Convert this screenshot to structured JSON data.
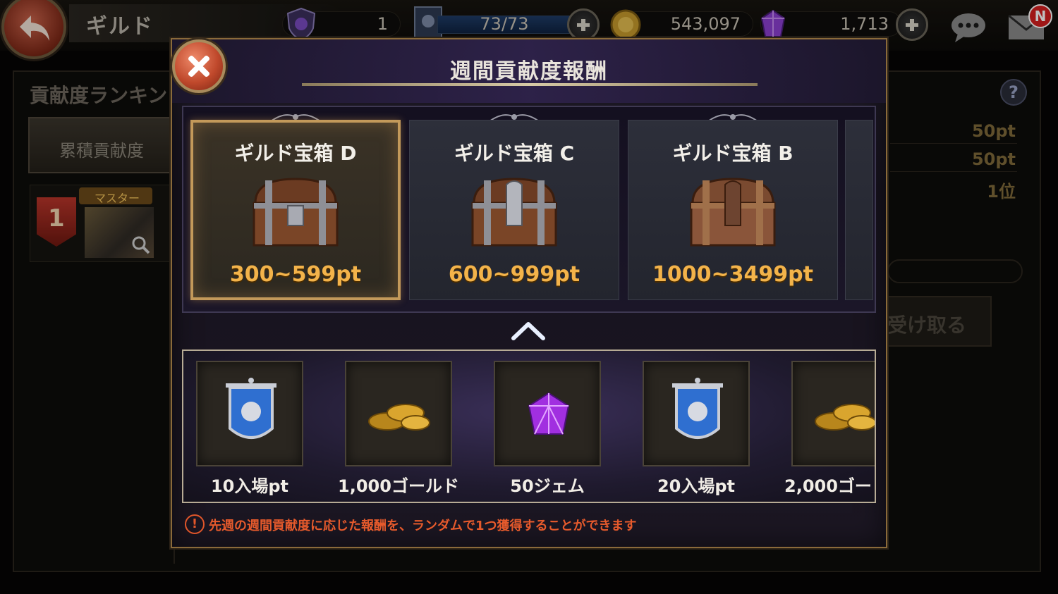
{
  "topbar": {
    "title": "ギルド",
    "guild_points": "1",
    "stamina": "73/73",
    "gold": "543,097",
    "gems": "1,713",
    "mail_badge": "N"
  },
  "background": {
    "ranking_title": "貢献度ランキン",
    "tab_cumulative": "累積貢献度",
    "rank_number": "1",
    "master_label": "マスター",
    "row_values": [
      "50pt",
      "50pt",
      "1位"
    ],
    "receive_button": "受け取る"
  },
  "modal": {
    "title": "週間貢献度報酬",
    "chests": [
      {
        "name": "ギルド宝箱 D",
        "range": "300~599pt",
        "selected": true
      },
      {
        "name": "ギルド宝箱 C",
        "range": "600~999pt",
        "selected": false
      },
      {
        "name": "ギルド宝箱 B",
        "range": "1000~3499pt",
        "selected": false
      }
    ],
    "rewards": [
      {
        "label": "10入場pt",
        "icon": "guild-banner-icon"
      },
      {
        "label": "1,000ゴールド",
        "icon": "gold-coins-icon"
      },
      {
        "label": "50ジェム",
        "icon": "purple-gem-icon"
      },
      {
        "label": "20入場pt",
        "icon": "guild-banner-icon"
      },
      {
        "label": "2,000ゴー",
        "icon": "gold-coins-icon"
      }
    ],
    "notice": "先週の週間貢献度に応じた報酬を、ランダムで1つ獲得することができます"
  },
  "colors": {
    "accent_gold": "#f3b34a",
    "notice_red": "#e65a2c",
    "selected_border": "#c3995a"
  }
}
